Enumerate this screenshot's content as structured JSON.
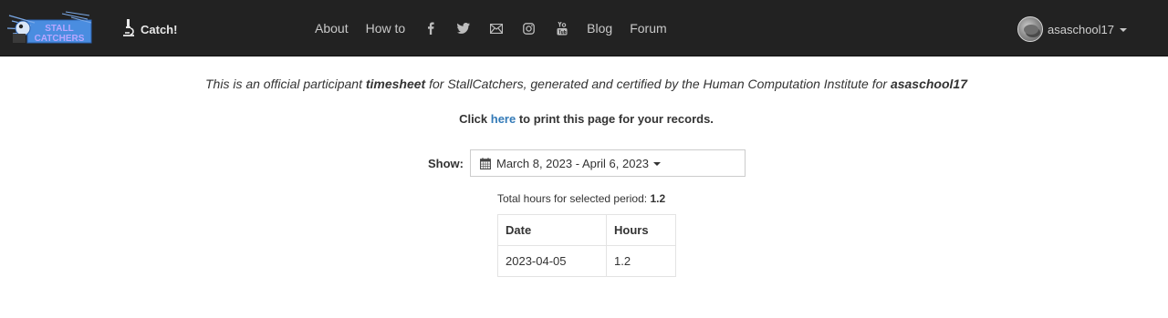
{
  "navbar": {
    "logo_text": "STALLCATCHERS",
    "catch_label": "Catch!",
    "links": {
      "about": "About",
      "howto": "How to",
      "blog": "Blog",
      "forum": "Forum"
    },
    "social_icons": [
      "facebook-icon",
      "twitter-icon",
      "mail-icon",
      "instagram-icon",
      "youtube-icon"
    ],
    "username": "asaschool17"
  },
  "intro": {
    "t1": "This is an official participant ",
    "t2": "timesheet",
    "t3": " for StallCatchers, generated and certified by the Human Computation Institute for ",
    "t4": "asaschool17"
  },
  "print": {
    "before": "Click ",
    "link": "here",
    "after": " to print this page for your records."
  },
  "filter": {
    "label": "Show:",
    "range": "March 8, 2023 - April 6, 2023"
  },
  "summary": {
    "label": "Total hours for selected period: ",
    "value": "1.2"
  },
  "table": {
    "headers": [
      "Date",
      "Hours"
    ],
    "rows": [
      [
        "2023-04-05",
        "1.2"
      ]
    ]
  },
  "colors": {
    "navbar_bg": "#222222",
    "link": "#337ab7",
    "logo_blue": "#4a8de0"
  }
}
